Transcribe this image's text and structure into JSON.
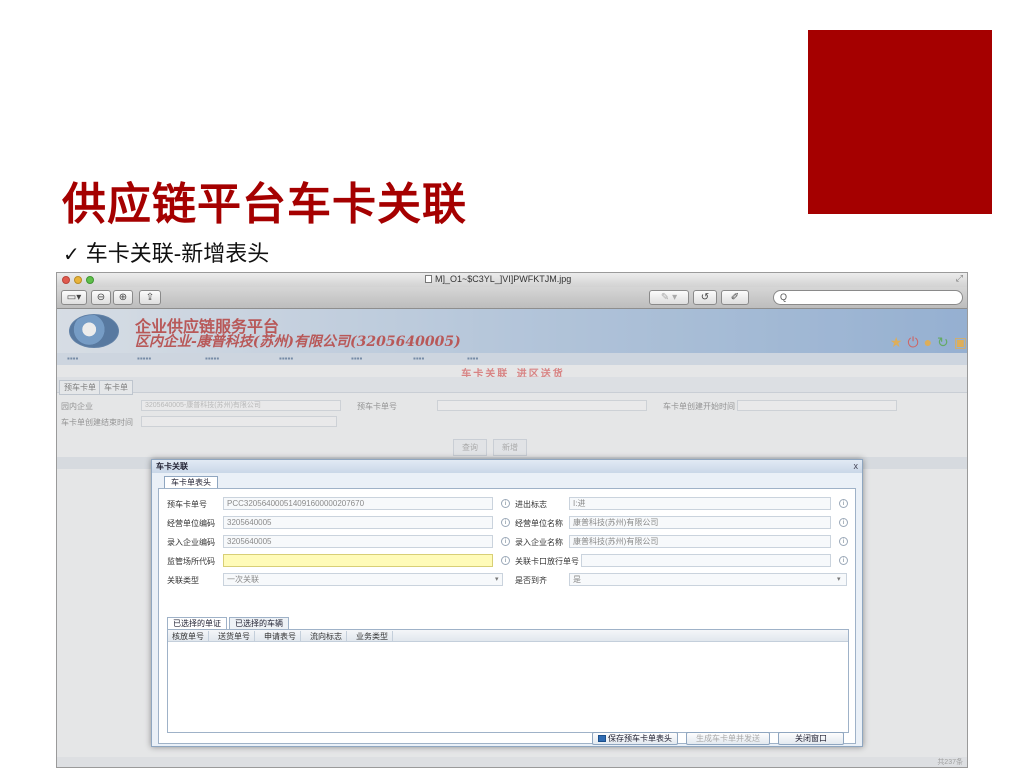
{
  "slide": {
    "title": "供应链平台车卡关联",
    "subtitle": "车卡关联-新增表头",
    "check": "✓",
    "accent_color": "#a50000"
  },
  "window": {
    "filename": "M]_O1~$C3YL_]VI]PWFKTJM.jpg",
    "search_placeholder": "Q"
  },
  "app": {
    "brand_line1": "企业供应链服务平台",
    "brand_line2": "区内企业-康普科技(苏州)有限公司(3205640005)",
    "page_heading": "车卡关联_进区送货",
    "tabs": [
      "预车卡单",
      "车卡单"
    ],
    "search": {
      "enterprise_label": "园内企业",
      "enterprise_value": "3205640005-康普科技(苏州)有限公司",
      "precard_label": "预车卡单号",
      "start_time_label": "车卡单创建开始时间",
      "end_time_label": "车卡单创建结束时间"
    },
    "buttons": {
      "query": "查询",
      "new": "新增"
    },
    "pager_text": "共237条"
  },
  "dialog": {
    "title": "车卡关联",
    "close": "x",
    "tab": "车卡单表头",
    "fields": {
      "precard_no_label": "预车卡单号",
      "precard_no_value": "PCC320564000514091600000207670",
      "in_out_label": "进出标志",
      "in_out_value": "I:进",
      "operator_code_label": "经营单位编码",
      "operator_code_value": "3205640005",
      "operator_name_label": "经营单位名称",
      "operator_name_value": "康普科技(苏州)有限公司",
      "entry_code_label": "录入企业编码",
      "entry_code_value": "3205640005",
      "entry_name_label": "录入企业名称",
      "entry_name_value": "康普科技(苏州)有限公司",
      "custom_code_label": "监管场所代码",
      "custom_code_value": "",
      "pass_no_label": "关联卡口放行单号",
      "pass_no_value": "",
      "link_type_label": "关联类型",
      "link_type_value": "一次关联",
      "arrival_label": "是否到齐",
      "arrival_value": "是"
    },
    "sub_tabs": [
      "已选择的单证",
      "已选择的车辆"
    ],
    "grid_columns": [
      "核放单号",
      "送货单号",
      "申请表号",
      "流向标志",
      "业务类型"
    ],
    "buttons": {
      "save": "保存预车卡单表头",
      "generate": "生成车卡单并发送",
      "close": "关闭窗口"
    }
  }
}
